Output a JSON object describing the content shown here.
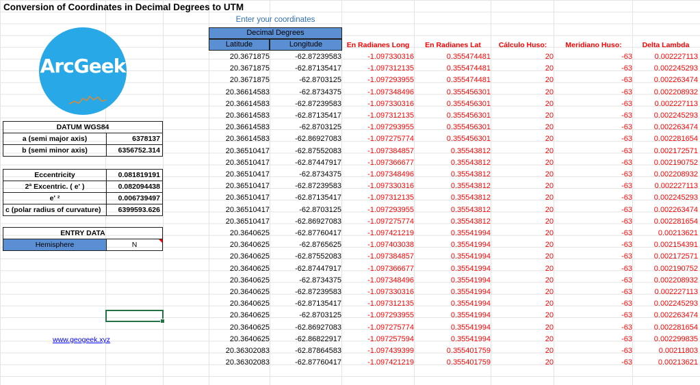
{
  "title": "Conversion of Coordinates in Decimal Degrees to UTM",
  "enter_label": "Enter your coordinates",
  "decimal_degrees_label": "Decimal Degrees",
  "columns": {
    "latitude": "Latitude",
    "longitude": "Longitude",
    "rad_long": "En Radianes Long",
    "rad_lat": "En Radianes Lat",
    "calc_huso": "Cálculo Huso:",
    "meridiano_huso": "Meridiano Huso:",
    "delta_lambda": "Delta Lambda"
  },
  "logo": {
    "text": "ArcGeek",
    "color": "#28a8e6"
  },
  "datum": {
    "title": "DATUM WGS84",
    "rows": [
      {
        "label": "a (semi major axis)",
        "value": "6378137"
      },
      {
        "label": "b (semi minor axis)",
        "value": "6356752.314"
      }
    ]
  },
  "params": [
    {
      "label": "Eccentricity",
      "value": "0.081819191"
    },
    {
      "label": "2ª Excentric. ( e' )",
      "value": "0.082094438"
    },
    {
      "label": "e' ²",
      "value": "0.006739497"
    },
    {
      "label": "c (polar radius of curvature)",
      "value": "6399593.626"
    }
  ],
  "entry": {
    "title": "ENTRY DATA",
    "hemisphere_label": "Hemisphere",
    "hemisphere_value": "N"
  },
  "link": "www.geogeek.xyz",
  "colors": {
    "header_blue": "#5b8fd4",
    "red_text": "#ff0000",
    "link": "#0000ff",
    "selection": "#217346"
  },
  "rows": [
    [
      "20.3671875",
      "-62.87239583",
      "-1.097330316",
      "0.355474481",
      "20",
      "-63",
      "0.002227113"
    ],
    [
      "20.3671875",
      "-62.87135417",
      "-1.097312135",
      "0.355474481",
      "20",
      "-63",
      "0.002245293"
    ],
    [
      "20.3671875",
      "-62.8703125",
      "-1.097293955",
      "0.355474481",
      "20",
      "-63",
      "0.002263474"
    ],
    [
      "20.36614583",
      "-62.8734375",
      "-1.097348496",
      "0.355456301",
      "20",
      "-63",
      "0.002208932"
    ],
    [
      "20.36614583",
      "-62.87239583",
      "-1.097330316",
      "0.355456301",
      "20",
      "-63",
      "0.002227113"
    ],
    [
      "20.36614583",
      "-62.87135417",
      "-1.097312135",
      "0.355456301",
      "20",
      "-63",
      "0.002245293"
    ],
    [
      "20.36614583",
      "-62.8703125",
      "-1.097293955",
      "0.355456301",
      "20",
      "-63",
      "0.002263474"
    ],
    [
      "20.36614583",
      "-62.86927083",
      "-1.097275774",
      "0.355456301",
      "20",
      "-63",
      "0.002281654"
    ],
    [
      "20.36510417",
      "-62.87552083",
      "-1.097384857",
      "0.35543812",
      "20",
      "-63",
      "0.002172571"
    ],
    [
      "20.36510417",
      "-62.87447917",
      "-1.097366677",
      "0.35543812",
      "20",
      "-63",
      "0.002190752"
    ],
    [
      "20.36510417",
      "-62.8734375",
      "-1.097348496",
      "0.35543812",
      "20",
      "-63",
      "0.002208932"
    ],
    [
      "20.36510417",
      "-62.87239583",
      "-1.097330316",
      "0.35543812",
      "20",
      "-63",
      "0.002227113"
    ],
    [
      "20.36510417",
      "-62.87135417",
      "-1.097312135",
      "0.35543812",
      "20",
      "-63",
      "0.002245293"
    ],
    [
      "20.36510417",
      "-62.8703125",
      "-1.097293955",
      "0.35543812",
      "20",
      "-63",
      "0.002263474"
    ],
    [
      "20.36510417",
      "-62.86927083",
      "-1.097275774",
      "0.35543812",
      "20",
      "-63",
      "0.002281654"
    ],
    [
      "20.3640625",
      "-62.87760417",
      "-1.097421219",
      "0.35541994",
      "20",
      "-63",
      "0.00213621"
    ],
    [
      "20.3640625",
      "-62.8765625",
      "-1.097403038",
      "0.35541994",
      "20",
      "-63",
      "0.002154391"
    ],
    [
      "20.3640625",
      "-62.87552083",
      "-1.097384857",
      "0.35541994",
      "20",
      "-63",
      "0.002172571"
    ],
    [
      "20.3640625",
      "-62.87447917",
      "-1.097366677",
      "0.35541994",
      "20",
      "-63",
      "0.002190752"
    ],
    [
      "20.3640625",
      "-62.8734375",
      "-1.097348496",
      "0.35541994",
      "20",
      "-63",
      "0.002208932"
    ],
    [
      "20.3640625",
      "-62.87239583",
      "-1.097330316",
      "0.35541994",
      "20",
      "-63",
      "0.002227113"
    ],
    [
      "20.3640625",
      "-62.87135417",
      "-1.097312135",
      "0.35541994",
      "20",
      "-63",
      "0.002245293"
    ],
    [
      "20.3640625",
      "-62.8703125",
      "-1.097293955",
      "0.35541994",
      "20",
      "-63",
      "0.002263474"
    ],
    [
      "20.3640625",
      "-62.86927083",
      "-1.097275774",
      "0.35541994",
      "20",
      "-63",
      "0.002281654"
    ],
    [
      "20.3640625",
      "-62.86822917",
      "-1.097257594",
      "0.35541994",
      "20",
      "-63",
      "0.002299835"
    ],
    [
      "20.36302083",
      "-62.87864583",
      "-1.097439399",
      "0.355401759",
      "20",
      "-63",
      "0.00211803"
    ],
    [
      "20.36302083",
      "-62.87760417",
      "-1.097421219",
      "0.355401759",
      "20",
      "-63",
      "0.00213621"
    ]
  ]
}
